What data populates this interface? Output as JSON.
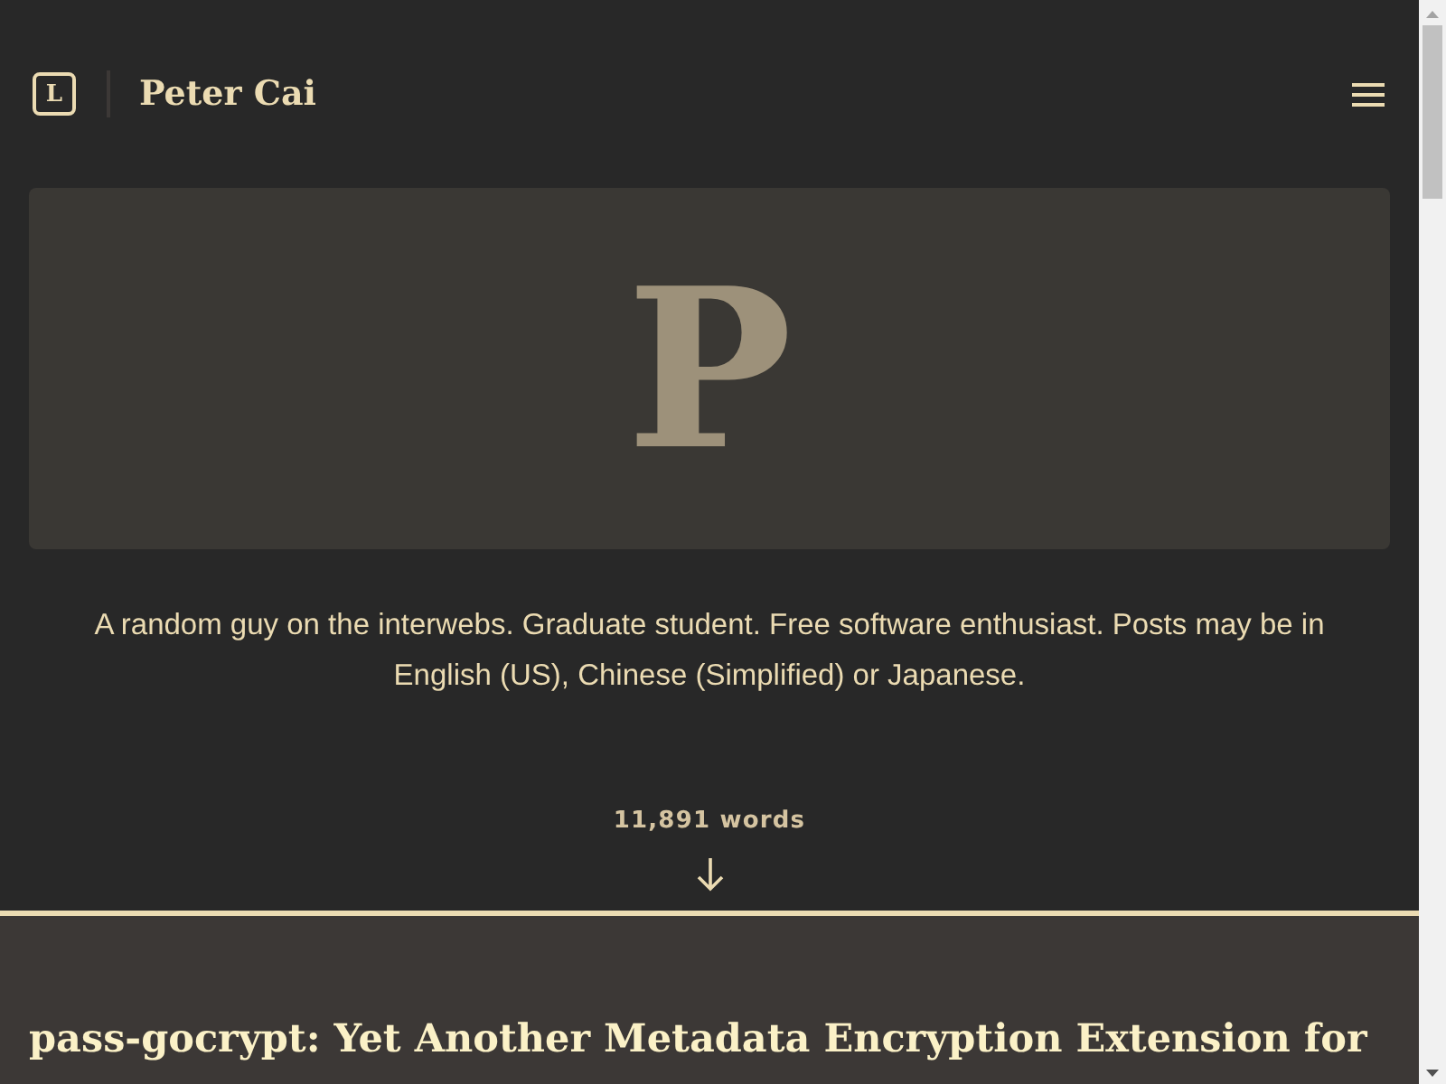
{
  "header": {
    "logo_letter": "L",
    "site_title": "Peter Cai"
  },
  "cover": {
    "letter": "P"
  },
  "description": "A random guy on the interwebs. Graduate student. Free software enthusiast. Posts may be in English (US), Chinese (Simplified) or Japanese.",
  "word_count": "11,891 words",
  "posts": [
    {
      "title": "pass-gocrypt: Yet Another Metadata Encryption Extension for"
    }
  ]
}
